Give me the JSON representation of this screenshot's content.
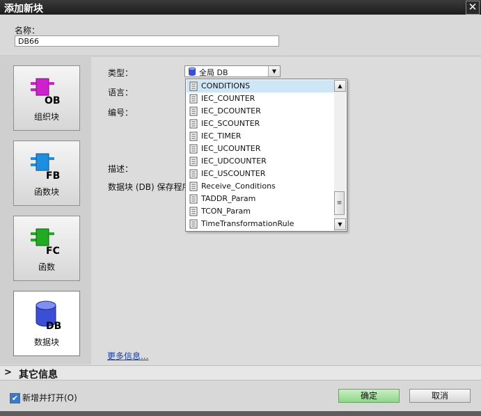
{
  "window": {
    "title": "添加新块",
    "close_glyph": "✕"
  },
  "name_field": {
    "label": "名称：",
    "value": "DB66"
  },
  "block_types": [
    {
      "label": "组织块",
      "icon": "ob-block-icon",
      "tag": "OB",
      "color": "#cc22cc"
    },
    {
      "label": "函数块",
      "icon": "fb-block-icon",
      "tag": "FB",
      "color": "#1e8fe0"
    },
    {
      "label": "函数",
      "icon": "fc-block-icon",
      "tag": "FC",
      "color": "#22aa22"
    },
    {
      "label": "数据块",
      "icon": "db-block-icon",
      "tag": "DB",
      "color": "#3a4fd6",
      "selected": true
    }
  ],
  "form": {
    "type_label": "类型：",
    "language_label": "语言：",
    "number_label": "编号：",
    "description_label": "描述：",
    "db_text": "数据块 (DB) 保存程序",
    "type_value": "全局 DB"
  },
  "dropdown": {
    "options": [
      "CONDITIONS",
      "IEC_COUNTER",
      "IEC_DCOUNTER",
      "IEC_SCOUNTER",
      "IEC_TIMER",
      "IEC_UCOUNTER",
      "IEC_UDCOUNTER",
      "IEC_USCOUNTER",
      "Receive_Conditions",
      "TADDR_Param",
      "TCON_Param",
      "TimeTransformationRule"
    ],
    "highlighted_index": 0,
    "scroll_up": "▲",
    "scroll_down": "▼",
    "thumb_grip": "≡"
  },
  "more_info": "更多信息...",
  "other_info": {
    "chevron": ">",
    "label": "其它信息"
  },
  "footer": {
    "checkbox_label": "新增并打开(O)",
    "checkbox_checked": true,
    "checkbox_glyph": "✔",
    "ok_label": "确定",
    "cancel_label": "取消"
  }
}
